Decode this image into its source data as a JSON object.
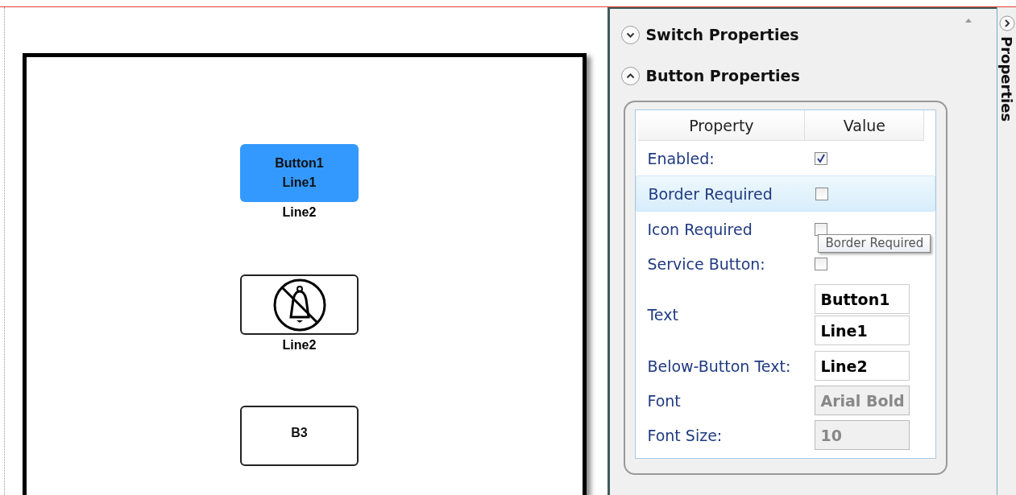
{
  "canvas": {
    "buttons": [
      {
        "kind": "filled",
        "lines": [
          "Button1",
          "Line1"
        ],
        "below": "Line2"
      },
      {
        "kind": "icon",
        "below": "Line2"
      },
      {
        "kind": "outline",
        "lines": [
          "B3"
        ]
      }
    ]
  },
  "panel": {
    "sections": [
      {
        "title": "Switch Properties",
        "expanded": false
      },
      {
        "title": "Button Properties",
        "expanded": true
      }
    ],
    "table": {
      "columns": [
        "Property",
        "Value"
      ],
      "rows": [
        {
          "kind": "checkbox",
          "label": "Enabled:",
          "checked": true,
          "selected": false
        },
        {
          "kind": "checkbox",
          "label": "Border Required",
          "checked": false,
          "selected": true
        },
        {
          "kind": "checkbox",
          "label": "Icon Required",
          "checked": false,
          "selected": false
        },
        {
          "kind": "checkbox",
          "label": "Service Button:",
          "checked": false,
          "selected": false
        },
        {
          "kind": "fields",
          "label": "Text",
          "values": [
            "Button1",
            "Line1"
          ],
          "disabled": false,
          "selected": false
        },
        {
          "kind": "fields",
          "label": "Below-Button Text:",
          "values": [
            "Line2"
          ],
          "disabled": false,
          "selected": false
        },
        {
          "kind": "fields",
          "label": "Font",
          "values": [
            "Arial Bold"
          ],
          "disabled": true,
          "selected": false
        },
        {
          "kind": "fields",
          "label": "Font Size:",
          "values": [
            "10"
          ],
          "disabled": true,
          "selected": false
        }
      ]
    },
    "tooltip": "Border Required"
  },
  "side_tab": {
    "label": "Properties"
  }
}
